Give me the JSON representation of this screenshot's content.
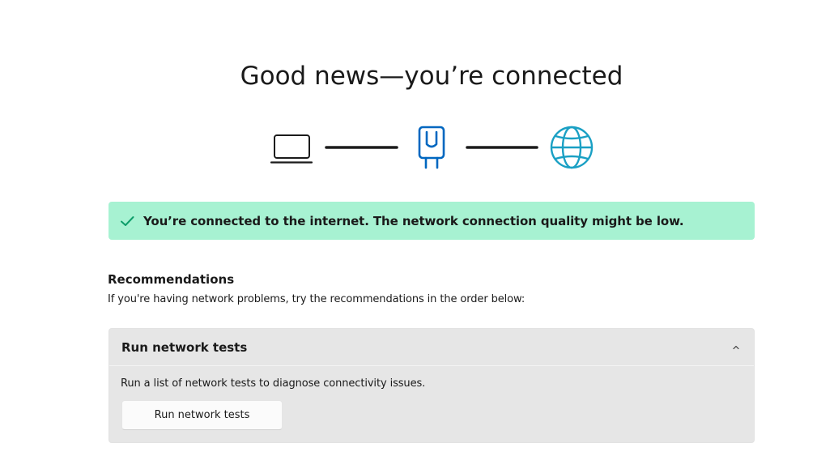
{
  "heading": "Good news—you’re connected",
  "diagram": {
    "icons": [
      "laptop-icon",
      "router-icon",
      "globe-icon"
    ],
    "colors": {
      "laptop": "#1b1b1b",
      "connector": "#1b1b1b",
      "router": "#0067c0",
      "globe": "#1aa0c4"
    }
  },
  "status_banner": {
    "icon": "checkmark-icon",
    "text": "You’re connected to the internet. The network connection quality might be low.",
    "background": "#a7f2d2",
    "icon_color": "#0e9e6a"
  },
  "recommendations": {
    "title": "Recommendations",
    "subtitle": "If you're having network problems, try the recommendations in the order below:",
    "items": [
      {
        "title": "Run network tests",
        "expanded": true,
        "chevron_icon": "chevron-up-icon",
        "description": "Run a list of network tests to diagnose connectivity issues.",
        "button_label": "Run network tests"
      }
    ]
  }
}
